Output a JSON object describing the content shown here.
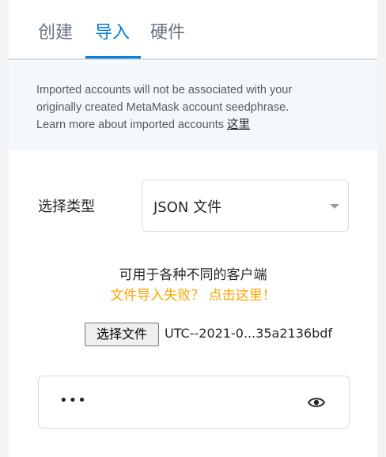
{
  "tabs": [
    {
      "label": "创建",
      "active": false
    },
    {
      "label": "导入",
      "active": true
    },
    {
      "label": "硬件",
      "active": false
    }
  ],
  "notice": {
    "line1": "Imported accounts will not be associated with your",
    "line2": "originally created MetaMask account seedphrase.",
    "line3": "Learn more about imported accounts ",
    "link": "这里"
  },
  "import_type": {
    "label": "选择类型",
    "selected": "JSON 文件"
  },
  "support_text": "可用于各种不同的客户端",
  "error_link": "文件导入失败？ 点击这里！",
  "file": {
    "button_label": "选择文件",
    "file_name": "UTC--2021-0...35a2136bdf"
  },
  "password": {
    "value": "•••"
  },
  "colors": {
    "accent": "#037dd6",
    "warning": "#f8a500",
    "notice_bg": "#f2f8fc"
  }
}
